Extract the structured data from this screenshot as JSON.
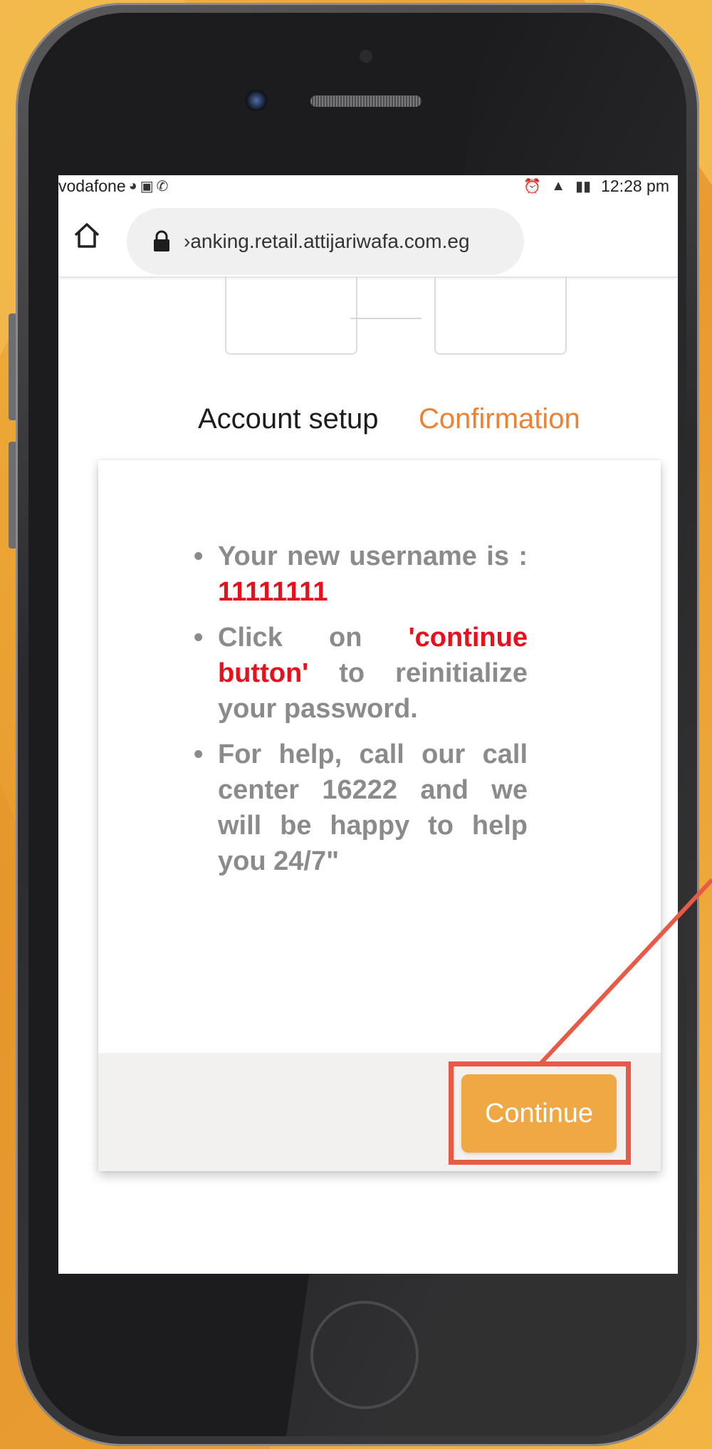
{
  "status_bar": {
    "carrier": "vodafone",
    "time": "12:28 pm"
  },
  "browser": {
    "url": "›anking.retail.attijariwafa.com.eg"
  },
  "steps": {
    "account_setup": "Account setup",
    "confirmation": "Confirmation"
  },
  "message": {
    "line1_prefix": "Your new username is : ",
    "username": "11111111",
    "line2_prefix": "Click on ",
    "line2_highlight": "'continue button'",
    "line2_suffix": " to reinitialize your password.",
    "line3": "For help, call our call center 16222 and we will be happy to help you 24/7\""
  },
  "actions": {
    "continue_label": "Continue"
  },
  "colors": {
    "accent_orange": "#efa843",
    "step_active": "#ee8233",
    "highlight_red": "#e8101c",
    "annotation": "#e85a46"
  }
}
